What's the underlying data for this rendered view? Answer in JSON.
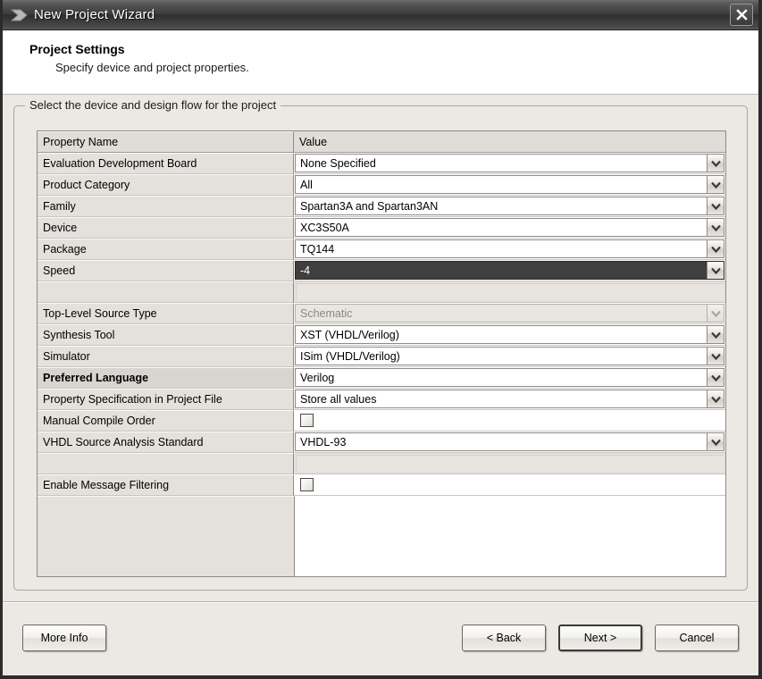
{
  "window": {
    "title": "New Project Wizard",
    "app_icon": "wizard-arrow-icon",
    "close_label": "×"
  },
  "header": {
    "title": "Project Settings",
    "subtitle": "Specify device and project properties."
  },
  "groupbox": {
    "legend": "Select the device and design flow for the project"
  },
  "table": {
    "columns": [
      "Property Name",
      "Value"
    ],
    "rows": [
      {
        "name": "Evaluation Development Board",
        "value": "None Specified",
        "type": "combo",
        "state": "normal"
      },
      {
        "name": "Product Category",
        "value": "All",
        "type": "combo",
        "state": "normal"
      },
      {
        "name": "Family",
        "value": "Spartan3A and Spartan3AN",
        "type": "combo",
        "state": "normal"
      },
      {
        "name": "Device",
        "value": "XC3S50A",
        "type": "combo",
        "state": "normal"
      },
      {
        "name": "Package",
        "value": "TQ144",
        "type": "combo",
        "state": "normal"
      },
      {
        "name": "Speed",
        "value": "-4",
        "type": "combo",
        "state": "selected"
      },
      {
        "name": "",
        "value": "",
        "type": "blank",
        "state": "normal"
      },
      {
        "name": "Top-Level Source Type",
        "value": "Schematic",
        "type": "combo",
        "state": "disabled"
      },
      {
        "name": "Synthesis Tool",
        "value": "XST (VHDL/Verilog)",
        "type": "combo",
        "state": "normal"
      },
      {
        "name": "Simulator",
        "value": "ISim (VHDL/Verilog)",
        "type": "combo",
        "state": "normal"
      },
      {
        "name": "Preferred Language",
        "value": "Verilog",
        "type": "combo",
        "state": "bold"
      },
      {
        "name": "Property Specification in Project File",
        "value": "Store all values",
        "type": "combo",
        "state": "normal"
      },
      {
        "name": "Manual Compile Order",
        "value": "",
        "type": "checkbox",
        "state": "unchecked"
      },
      {
        "name": "VHDL Source Analysis Standard",
        "value": "VHDL-93",
        "type": "combo",
        "state": "normal"
      },
      {
        "name": "",
        "value": "",
        "type": "blank",
        "state": "normal"
      },
      {
        "name": "Enable Message Filtering",
        "value": "",
        "type": "checkbox",
        "state": "unchecked"
      }
    ]
  },
  "footer": {
    "more_info": "More Info",
    "back": "< Back",
    "next": "Next >",
    "cancel": "Cancel"
  },
  "colors": {
    "titlebar_dark": "#2e2e2e",
    "dialog_bg": "#ece9e4",
    "selection": "#3f3f3f",
    "cell_name_bg": "#e4e1dc"
  }
}
